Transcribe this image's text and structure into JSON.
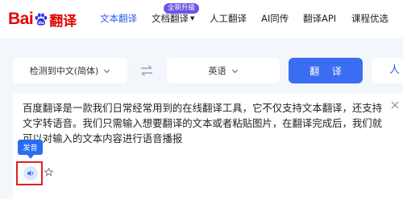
{
  "header": {
    "logo": {
      "bai": "Bai",
      "du": "du",
      "fanyi": "翻译",
      "icon": "baidu-paw-icon"
    },
    "nav": [
      {
        "label": "文本翻译",
        "active": true
      },
      {
        "label": "文档翻译",
        "has_dropdown": true,
        "badge": "全新升级"
      },
      {
        "label": "人工翻译"
      },
      {
        "label": "AI同传"
      },
      {
        "label": "翻译API"
      },
      {
        "label": "课程优选"
      }
    ]
  },
  "toolbar": {
    "source_lang": "检测到中文(简体)",
    "swap_icon": "swap-arrows-icon",
    "target_lang": "英语",
    "translate_label": "翻 译",
    "partial_label": "人"
  },
  "input": {
    "text": "百度翻译是一款我们日常经常用到的在线翻译工具，它不仅支持文本翻译，还支持文字转语音。我们只需输入想要翻译的文本或者粘贴图片，在翻译完成后，我们就可以对输入的文本内容进行语音播报",
    "tooltip": "发音",
    "clear_icon": "close-icon",
    "speaker_icon": "speaker-icon",
    "favorite_icon": "star-icon"
  },
  "colors": {
    "accent": "#3b6df2",
    "brand_red": "#e10601",
    "brand_blue": "#2932e1",
    "badge_purple": "#6a55e8",
    "highlight_frame": "#e02020",
    "background": "#f3f6fb"
  }
}
